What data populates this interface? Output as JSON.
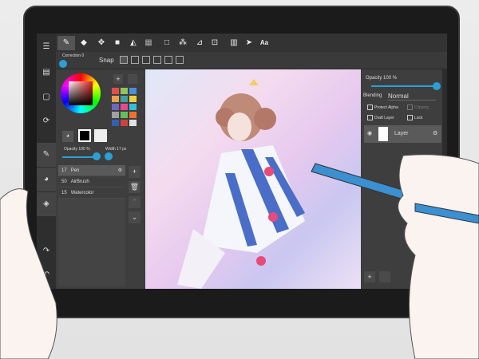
{
  "toolbar": {
    "tools": [
      "pen-icon",
      "eraser-icon",
      "move-icon",
      "fill-rect-icon",
      "bucket-icon",
      "gradient-icon",
      "select-icon",
      "magic-wand-icon",
      "select-pen-icon",
      "select-eraser-icon",
      "panel-icon",
      "operation-icon",
      "text-icon"
    ],
    "text_tool_label": "Aa"
  },
  "subbar": {
    "correction_label": "Correction 0",
    "snap_label": "Snap"
  },
  "left_panel": {
    "opacity_label": "Opacity 100 %",
    "width_label": "Width",
    "width_value": "17 px",
    "opacity_value": 1.0,
    "brushes": [
      {
        "size": "17",
        "name": "Pen",
        "selected": true
      },
      {
        "size": "50",
        "name": "AirBrush",
        "selected": false
      },
      {
        "size": "15",
        "name": "Watercolor",
        "selected": false
      }
    ],
    "palette": [
      "#e0504f",
      "#8fc456",
      "#4a8fd8",
      "#f0a04a",
      "#40a0a0",
      "#f0d040",
      "#6a6ac0",
      "#e84a8a",
      "#30c0e0",
      "#a0a0a0",
      "#60c060",
      "#f07030",
      "#3060b0",
      "#d04040",
      "#e0e0e0"
    ]
  },
  "right_panel": {
    "opacity_label": "Opacity 100 %",
    "opacity_value": 1.0,
    "blending_label": "Blending",
    "blending_value": "Normal",
    "protect_alpha": "Protect Alpha",
    "clipping": "Clipping",
    "draft_layer": "Draft Layer",
    "lock": "Lock",
    "layer_name": "Layer"
  },
  "colors": {
    "accent": "#2b9fd6",
    "panel": "#3e3e3e",
    "toolbar": "#333333"
  }
}
